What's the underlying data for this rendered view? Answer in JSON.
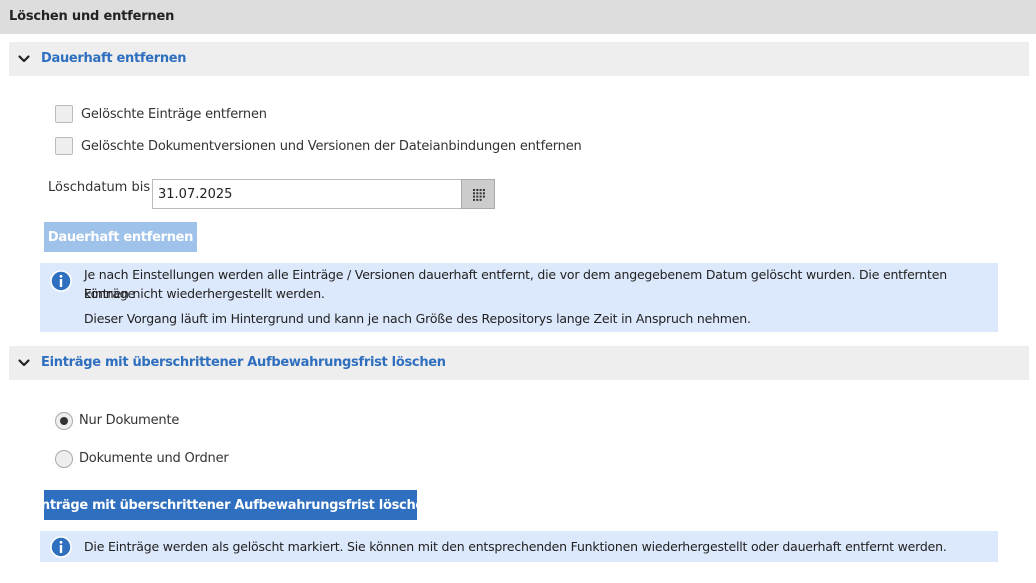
{
  "page": {
    "title": "Löschen und entfernen"
  },
  "sections": {
    "permanent": {
      "title": "Dauerhaft entfernen",
      "checkbox_entries": "Gelöschte Einträge entfernen",
      "checkbox_versions": "Gelöschte Dokumentversionen und Versionen der Dateianbindungen entfernen",
      "date_label": "Löschdatum bis",
      "date_value": "31.07.2025",
      "button_label": "Dauerhaft entfernen",
      "info_line1": "Je nach Einstellungen werden alle Einträge / Versionen dauerhaft entfernt, die vor dem angegebenem Datum gelöscht wurden. Die entfernten Einträge",
      "info_line2": "können nicht wiederhergestellt werden.",
      "info_line3": "Dieser Vorgang läuft im Hintergrund und kann je nach Größe des Repositorys lange Zeit in Anspruch nehmen."
    },
    "retention": {
      "title": "Einträge mit überschrittener Aufbewahrungsfrist löschen",
      "radio_documents": "Nur Dokumente",
      "radio_documents_folders": "Dokumente und Ordner",
      "selected_option": "Nur Dokumente",
      "button_label": "Einträge mit überschrittener Aufbewahrungsfrist löschen",
      "info_line1": "Die Einträge werden als gelöscht markiert. Sie können mit den entsprechenden Funktionen wiederhergestellt oder dauerhaft entfernt werden."
    }
  },
  "icons": {
    "chevron": "chevron-down-icon",
    "calendar": "calendar-icon",
    "info": "info-icon"
  },
  "colors": {
    "accent": "#2e6fbf",
    "button_disabled": "#9fc2ea",
    "info_background": "#dce8fb",
    "header_background": "#eeeeee",
    "topbar_background": "#dddddd"
  }
}
